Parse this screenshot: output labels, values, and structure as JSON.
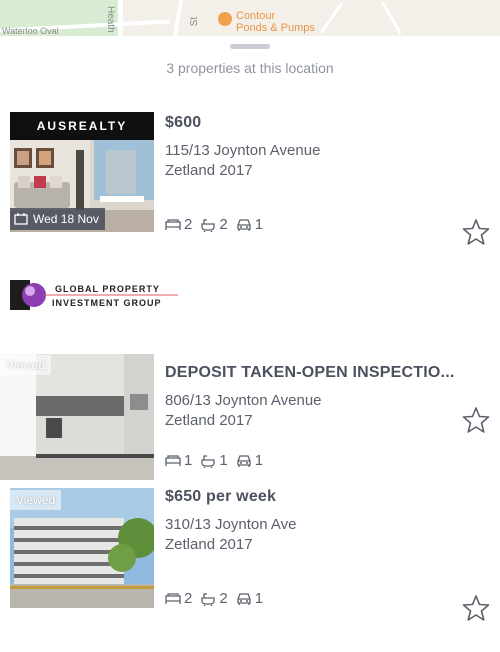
{
  "map": {
    "street_label": "St",
    "partial_label": "Waterloo Oval",
    "vertical_label": "Heath St",
    "poi_line1": "Contour",
    "poi_line2": "Ponds & Pumps"
  },
  "sheet": {
    "count_text": "3 properties at this location"
  },
  "listings": [
    {
      "agency": "AUSREALTY",
      "inspection": "Wed 18 Nov",
      "price": "$600",
      "address_line1": "115/13 Joynton Avenue",
      "address_line2": "Zetland 2017",
      "bedrooms": "2",
      "bathrooms": "2",
      "parking": "1"
    },
    {
      "agency_line1": "GLOBAL PROPERTY",
      "agency_line2": "INVESTMENT GROUP",
      "viewed": "Viewed",
      "price": "DEPOSIT TAKEN-OPEN INSPECTIO...",
      "address_line1": "806/13 Joynton Avenue",
      "address_line2": "Zetland 2017",
      "bedrooms": "1",
      "bathrooms": "1",
      "parking": "1"
    },
    {
      "viewed": "Viewed",
      "price": "$650 per week",
      "address_line1": "310/13 Joynton Ave",
      "address_line2": "Zetland 2017",
      "bedrooms": "2",
      "bathrooms": "2",
      "parking": "1"
    }
  ],
  "icons": {
    "bed": "bed-icon",
    "bath": "bath-icon",
    "car": "car-icon",
    "favourite": "star-outline-icon",
    "calendar": "calendar-icon"
  },
  "colors": {
    "text": "#4b515e",
    "muted": "#8f949e",
    "poi": "#f0a14a"
  }
}
